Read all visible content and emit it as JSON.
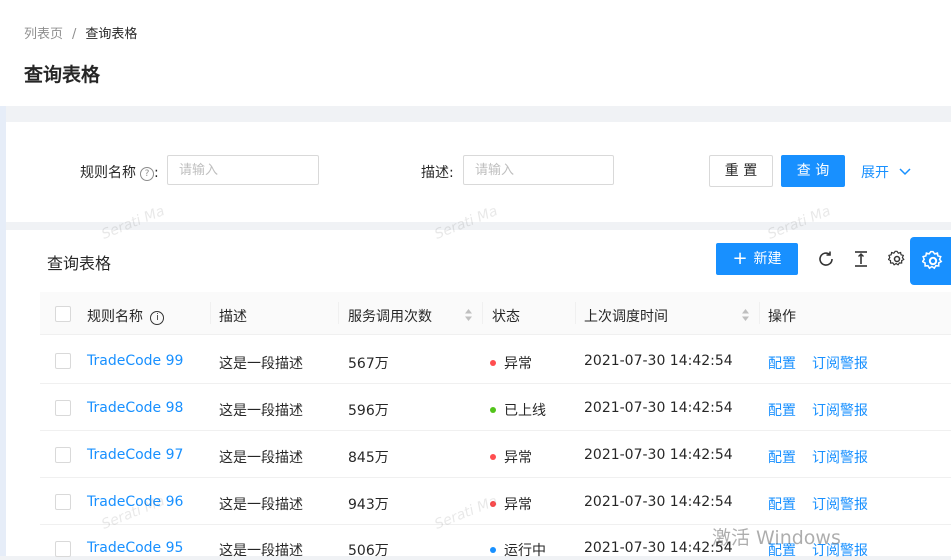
{
  "breadcrumb": {
    "items": [
      "列表页",
      "查询表格"
    ],
    "separator": "/"
  },
  "page": {
    "title": "查询表格"
  },
  "search_form": {
    "rule_name_label": "规则名称",
    "rule_name_placeholder": "请输入",
    "desc_label": "描述",
    "desc_placeholder": "请输入",
    "reset_label": "重 置",
    "query_label": "查 询",
    "expand_label": "展开"
  },
  "table": {
    "title": "查询表格",
    "new_button_label": "新建",
    "columns": [
      "规则名称",
      "描述",
      "服务调用次数",
      "状态",
      "上次调度时间",
      "操作"
    ],
    "rows": [
      {
        "name": "TradeCode 99",
        "desc": "这是一段描述",
        "calls": "567万",
        "status": "异常",
        "status_color": "#ff4d4f",
        "time": "2021-07-30 14:42:54",
        "action1": "配置",
        "action2": "订阅警报"
      },
      {
        "name": "TradeCode 98",
        "desc": "这是一段描述",
        "calls": "596万",
        "status": "已上线",
        "status_color": "#52c41a",
        "time": "2021-07-30 14:42:54",
        "action1": "配置",
        "action2": "订阅警报"
      },
      {
        "name": "TradeCode 97",
        "desc": "这是一段描述",
        "calls": "845万",
        "status": "异常",
        "status_color": "#ff4d4f",
        "time": "2021-07-30 14:42:54",
        "action1": "配置",
        "action2": "订阅警报"
      },
      {
        "name": "TradeCode 96",
        "desc": "这是一段描述",
        "calls": "943万",
        "status": "异常",
        "status_color": "#ff4d4f",
        "time": "2021-07-30 14:42:54",
        "action1": "配置",
        "action2": "订阅警报"
      },
      {
        "name": "TradeCode 95",
        "desc": "这是一段描述",
        "calls": "506万",
        "status": "运行中",
        "status_color": "#1890ff",
        "time": "2021-07-30 14:42:54",
        "action1": "配置",
        "action2": "订阅警报"
      }
    ]
  },
  "watermark": "Serati Ma",
  "os_overlay": "激活 Windows",
  "theme": {
    "primary": "#1890ff"
  }
}
